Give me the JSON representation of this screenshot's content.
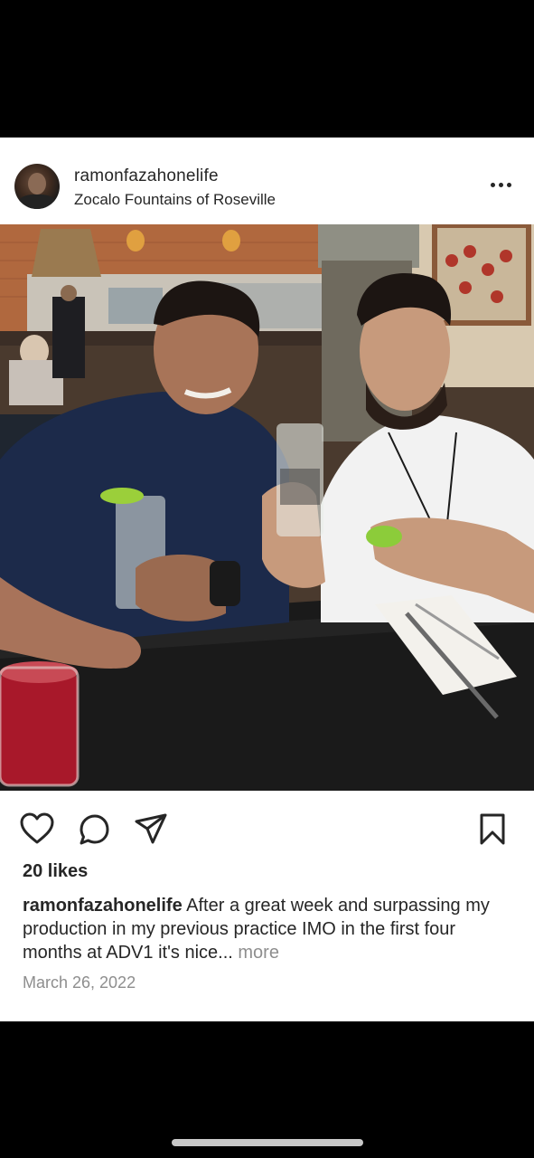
{
  "post": {
    "username": "ramonfazahonelife",
    "location": "Zocalo Fountains of Roseville",
    "likes": "20 likes",
    "caption_user": "ramonfazahonelife",
    "caption_text": "After a great week and surpassing my production in my previous practice IMO in the first four months at ADV1 it's nice...",
    "caption_more": "more",
    "date": "March 26, 2022"
  },
  "icons": {
    "like": "heart-icon",
    "comment": "comment-icon",
    "share": "send-icon",
    "save": "bookmark-icon",
    "menu": "more-horizontal-icon"
  },
  "colors": {
    "text": "#262626",
    "muted": "#8e8e8e",
    "background": "#ffffff"
  }
}
